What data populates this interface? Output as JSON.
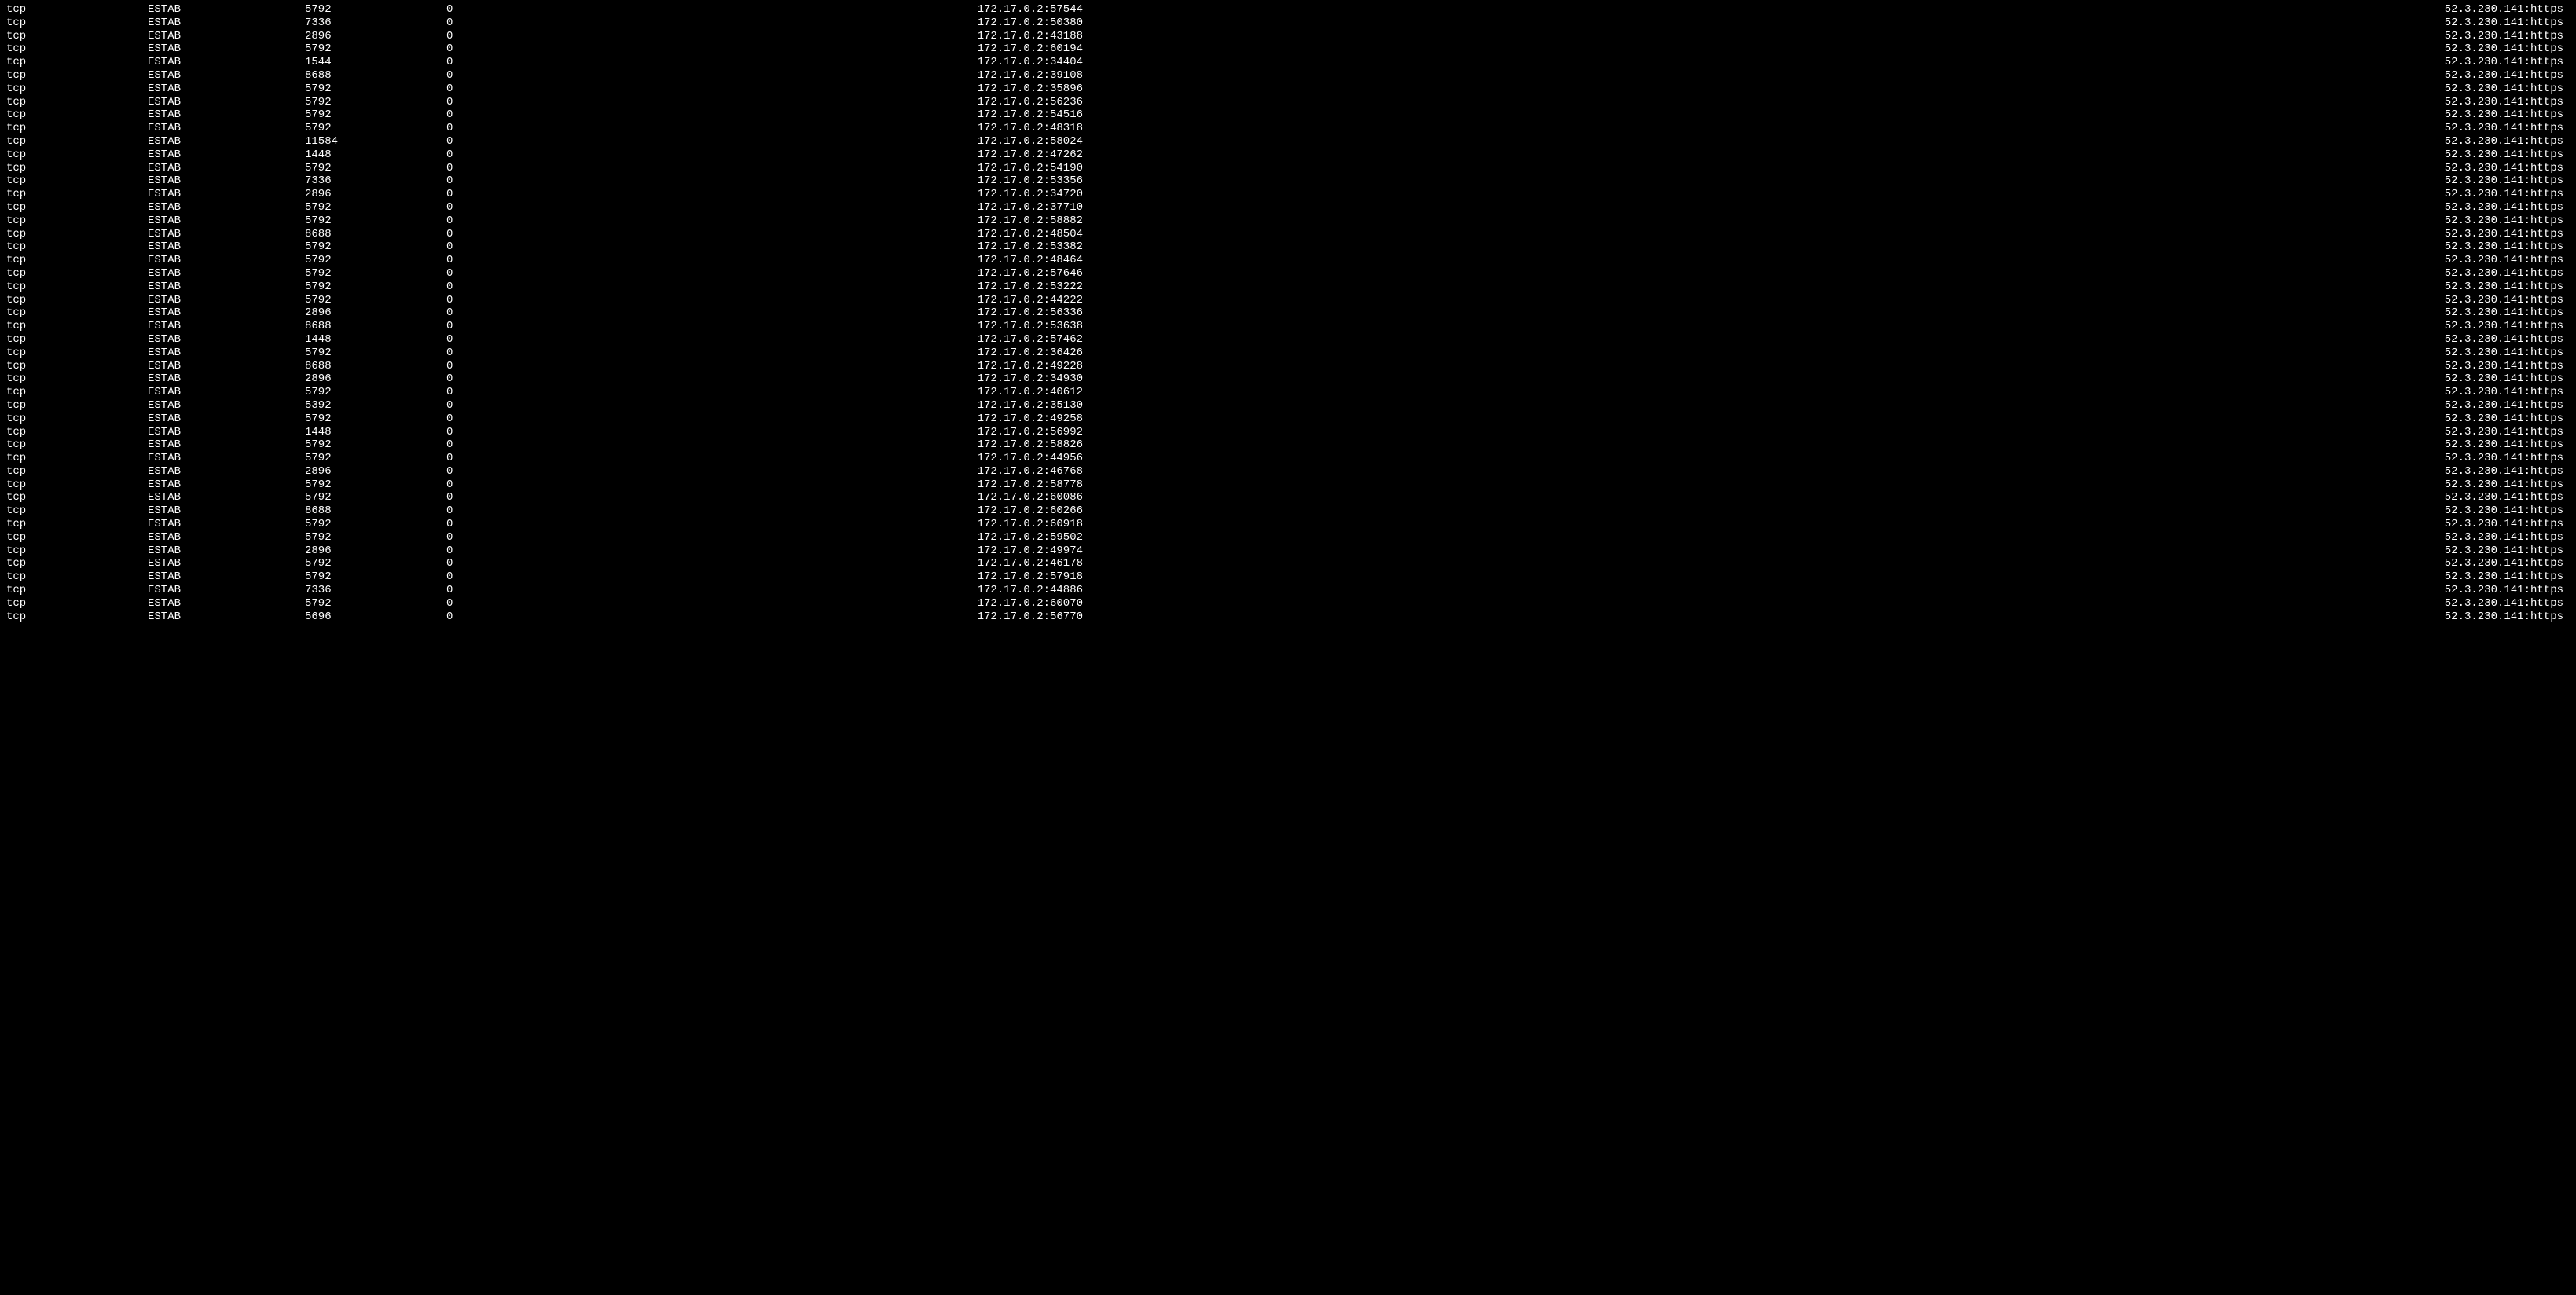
{
  "rows": [
    {
      "netid": "tcp",
      "state": "ESTAB",
      "recvq": "5792",
      "sendq": "0",
      "local": "172.17.0.2:57544",
      "peer": "52.3.230.141:https"
    },
    {
      "netid": "tcp",
      "state": "ESTAB",
      "recvq": "7336",
      "sendq": "0",
      "local": "172.17.0.2:50380",
      "peer": "52.3.230.141:https"
    },
    {
      "netid": "tcp",
      "state": "ESTAB",
      "recvq": "2896",
      "sendq": "0",
      "local": "172.17.0.2:43188",
      "peer": "52.3.230.141:https"
    },
    {
      "netid": "tcp",
      "state": "ESTAB",
      "recvq": "5792",
      "sendq": "0",
      "local": "172.17.0.2:60194",
      "peer": "52.3.230.141:https"
    },
    {
      "netid": "tcp",
      "state": "ESTAB",
      "recvq": "1544",
      "sendq": "0",
      "local": "172.17.0.2:34404",
      "peer": "52.3.230.141:https"
    },
    {
      "netid": "tcp",
      "state": "ESTAB",
      "recvq": "8688",
      "sendq": "0",
      "local": "172.17.0.2:39108",
      "peer": "52.3.230.141:https"
    },
    {
      "netid": "tcp",
      "state": "ESTAB",
      "recvq": "5792",
      "sendq": "0",
      "local": "172.17.0.2:35896",
      "peer": "52.3.230.141:https"
    },
    {
      "netid": "tcp",
      "state": "ESTAB",
      "recvq": "5792",
      "sendq": "0",
      "local": "172.17.0.2:56236",
      "peer": "52.3.230.141:https"
    },
    {
      "netid": "tcp",
      "state": "ESTAB",
      "recvq": "5792",
      "sendq": "0",
      "local": "172.17.0.2:54516",
      "peer": "52.3.230.141:https"
    },
    {
      "netid": "tcp",
      "state": "ESTAB",
      "recvq": "5792",
      "sendq": "0",
      "local": "172.17.0.2:48318",
      "peer": "52.3.230.141:https"
    },
    {
      "netid": "tcp",
      "state": "ESTAB",
      "recvq": "11584",
      "sendq": "0",
      "local": "172.17.0.2:58024",
      "peer": "52.3.230.141:https"
    },
    {
      "netid": "tcp",
      "state": "ESTAB",
      "recvq": "1448",
      "sendq": "0",
      "local": "172.17.0.2:47262",
      "peer": "52.3.230.141:https"
    },
    {
      "netid": "tcp",
      "state": "ESTAB",
      "recvq": "5792",
      "sendq": "0",
      "local": "172.17.0.2:54190",
      "peer": "52.3.230.141:https"
    },
    {
      "netid": "tcp",
      "state": "ESTAB",
      "recvq": "7336",
      "sendq": "0",
      "local": "172.17.0.2:53356",
      "peer": "52.3.230.141:https"
    },
    {
      "netid": "tcp",
      "state": "ESTAB",
      "recvq": "2896",
      "sendq": "0",
      "local": "172.17.0.2:34720",
      "peer": "52.3.230.141:https"
    },
    {
      "netid": "tcp",
      "state": "ESTAB",
      "recvq": "5792",
      "sendq": "0",
      "local": "172.17.0.2:37710",
      "peer": "52.3.230.141:https"
    },
    {
      "netid": "tcp",
      "state": "ESTAB",
      "recvq": "5792",
      "sendq": "0",
      "local": "172.17.0.2:58882",
      "peer": "52.3.230.141:https"
    },
    {
      "netid": "tcp",
      "state": "ESTAB",
      "recvq": "8688",
      "sendq": "0",
      "local": "172.17.0.2:48504",
      "peer": "52.3.230.141:https"
    },
    {
      "netid": "tcp",
      "state": "ESTAB",
      "recvq": "5792",
      "sendq": "0",
      "local": "172.17.0.2:53382",
      "peer": "52.3.230.141:https"
    },
    {
      "netid": "tcp",
      "state": "ESTAB",
      "recvq": "5792",
      "sendq": "0",
      "local": "172.17.0.2:48464",
      "peer": "52.3.230.141:https"
    },
    {
      "netid": "tcp",
      "state": "ESTAB",
      "recvq": "5792",
      "sendq": "0",
      "local": "172.17.0.2:57646",
      "peer": "52.3.230.141:https"
    },
    {
      "netid": "tcp",
      "state": "ESTAB",
      "recvq": "5792",
      "sendq": "0",
      "local": "172.17.0.2:53222",
      "peer": "52.3.230.141:https"
    },
    {
      "netid": "tcp",
      "state": "ESTAB",
      "recvq": "5792",
      "sendq": "0",
      "local": "172.17.0.2:44222",
      "peer": "52.3.230.141:https"
    },
    {
      "netid": "tcp",
      "state": "ESTAB",
      "recvq": "2896",
      "sendq": "0",
      "local": "172.17.0.2:56336",
      "peer": "52.3.230.141:https"
    },
    {
      "netid": "tcp",
      "state": "ESTAB",
      "recvq": "8688",
      "sendq": "0",
      "local": "172.17.0.2:53638",
      "peer": "52.3.230.141:https"
    },
    {
      "netid": "tcp",
      "state": "ESTAB",
      "recvq": "1448",
      "sendq": "0",
      "local": "172.17.0.2:57462",
      "peer": "52.3.230.141:https"
    },
    {
      "netid": "tcp",
      "state": "ESTAB",
      "recvq": "5792",
      "sendq": "0",
      "local": "172.17.0.2:36426",
      "peer": "52.3.230.141:https"
    },
    {
      "netid": "tcp",
      "state": "ESTAB",
      "recvq": "8688",
      "sendq": "0",
      "local": "172.17.0.2:49228",
      "peer": "52.3.230.141:https"
    },
    {
      "netid": "tcp",
      "state": "ESTAB",
      "recvq": "2896",
      "sendq": "0",
      "local": "172.17.0.2:34930",
      "peer": "52.3.230.141:https"
    },
    {
      "netid": "tcp",
      "state": "ESTAB",
      "recvq": "5792",
      "sendq": "0",
      "local": "172.17.0.2:40612",
      "peer": "52.3.230.141:https"
    },
    {
      "netid": "tcp",
      "state": "ESTAB",
      "recvq": "5392",
      "sendq": "0",
      "local": "172.17.0.2:35130",
      "peer": "52.3.230.141:https"
    },
    {
      "netid": "tcp",
      "state": "ESTAB",
      "recvq": "5792",
      "sendq": "0",
      "local": "172.17.0.2:49258",
      "peer": "52.3.230.141:https"
    },
    {
      "netid": "tcp",
      "state": "ESTAB",
      "recvq": "1448",
      "sendq": "0",
      "local": "172.17.0.2:56992",
      "peer": "52.3.230.141:https"
    },
    {
      "netid": "tcp",
      "state": "ESTAB",
      "recvq": "5792",
      "sendq": "0",
      "local": "172.17.0.2:58826",
      "peer": "52.3.230.141:https"
    },
    {
      "netid": "tcp",
      "state": "ESTAB",
      "recvq": "5792",
      "sendq": "0",
      "local": "172.17.0.2:44956",
      "peer": "52.3.230.141:https"
    },
    {
      "netid": "tcp",
      "state": "ESTAB",
      "recvq": "2896",
      "sendq": "0",
      "local": "172.17.0.2:46768",
      "peer": "52.3.230.141:https"
    },
    {
      "netid": "tcp",
      "state": "ESTAB",
      "recvq": "5792",
      "sendq": "0",
      "local": "172.17.0.2:58778",
      "peer": "52.3.230.141:https"
    },
    {
      "netid": "tcp",
      "state": "ESTAB",
      "recvq": "5792",
      "sendq": "0",
      "local": "172.17.0.2:60086",
      "peer": "52.3.230.141:https"
    },
    {
      "netid": "tcp",
      "state": "ESTAB",
      "recvq": "8688",
      "sendq": "0",
      "local": "172.17.0.2:60266",
      "peer": "52.3.230.141:https"
    },
    {
      "netid": "tcp",
      "state": "ESTAB",
      "recvq": "5792",
      "sendq": "0",
      "local": "172.17.0.2:60918",
      "peer": "52.3.230.141:https"
    },
    {
      "netid": "tcp",
      "state": "ESTAB",
      "recvq": "5792",
      "sendq": "0",
      "local": "172.17.0.2:59502",
      "peer": "52.3.230.141:https"
    },
    {
      "netid": "tcp",
      "state": "ESTAB",
      "recvq": "2896",
      "sendq": "0",
      "local": "172.17.0.2:49974",
      "peer": "52.3.230.141:https"
    },
    {
      "netid": "tcp",
      "state": "ESTAB",
      "recvq": "5792",
      "sendq": "0",
      "local": "172.17.0.2:46178",
      "peer": "52.3.230.141:https"
    },
    {
      "netid": "tcp",
      "state": "ESTAB",
      "recvq": "5792",
      "sendq": "0",
      "local": "172.17.0.2:57918",
      "peer": "52.3.230.141:https"
    },
    {
      "netid": "tcp",
      "state": "ESTAB",
      "recvq": "7336",
      "sendq": "0",
      "local": "172.17.0.2:44886",
      "peer": "52.3.230.141:https"
    },
    {
      "netid": "tcp",
      "state": "ESTAB",
      "recvq": "5792",
      "sendq": "0",
      "local": "172.17.0.2:60070",
      "peer": "52.3.230.141:https"
    },
    {
      "netid": "tcp",
      "state": "ESTAB",
      "recvq": "5696",
      "sendq": "0",
      "local": "172.17.0.2:56770",
      "peer": "52.3.230.141:https"
    }
  ]
}
